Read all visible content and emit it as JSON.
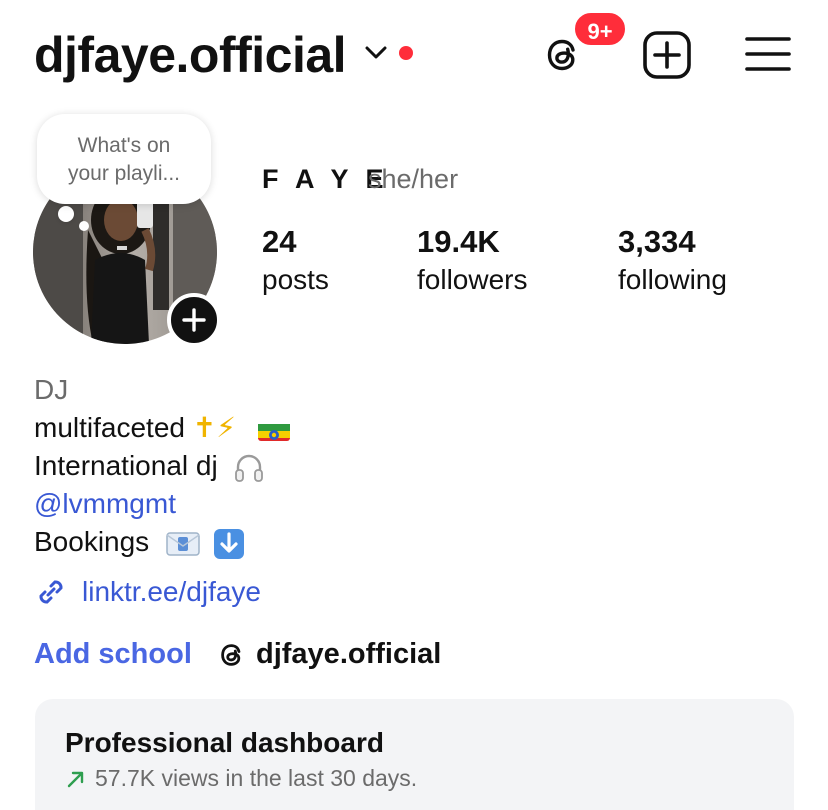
{
  "header": {
    "username": "djfaye.official",
    "notification_badge": "9+",
    "accent_red": "#ff2d3a"
  },
  "avatar": {
    "note_text": "What's on your playli..."
  },
  "profile": {
    "display_name": "F A Y E",
    "pronouns": "she/her",
    "stats": [
      {
        "value": "24",
        "label": "posts"
      },
      {
        "value": "19.4K",
        "label": "followers"
      },
      {
        "value": "3,334",
        "label": "following"
      }
    ]
  },
  "bio": {
    "category": "DJ",
    "line1": "multifaceted",
    "line1_emojis": "✝⚡",
    "line2": "International dj",
    "mention": "@lvmmgmt",
    "line4": "Bookings",
    "link": "linktr.ee/djfaye",
    "link_color": "#3958d4"
  },
  "actions": {
    "add_school": "Add school",
    "threads_handle": "djfaye.official"
  },
  "dashboard": {
    "title": "Professional dashboard",
    "stat": "57.7K views in the last 30 days.",
    "trend_color": "#2e9e4f"
  },
  "icons": [
    "chevron-down-icon",
    "threads-icon",
    "plus-square-icon",
    "hamburger-menu-icon",
    "plus-icon",
    "link-icon",
    "headphones-icon",
    "envelope-icon",
    "down-arrow-icon",
    "trend-up-icon",
    "ethiopia-flag-icon"
  ]
}
